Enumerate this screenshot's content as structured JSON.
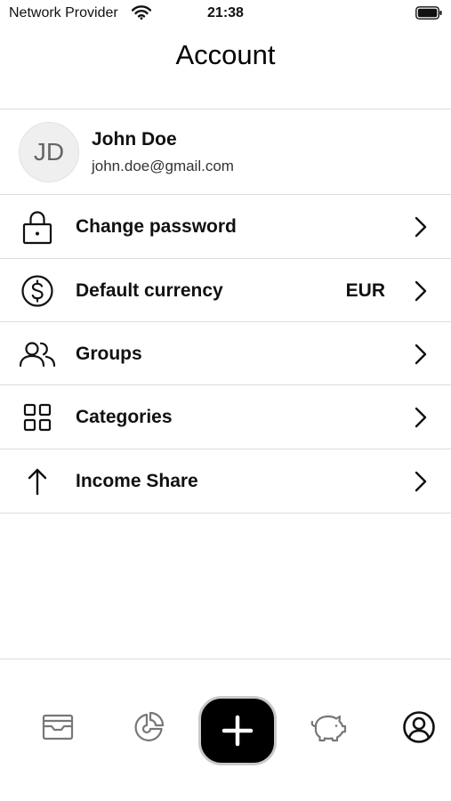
{
  "status_bar": {
    "carrier": "Network Provider",
    "time": "21:38",
    "wifi_icon": "wifi-icon",
    "battery_icon": "battery-icon"
  },
  "header": {
    "title": "Account"
  },
  "profile": {
    "initials": "JD",
    "name": "John Doe",
    "email": "john.doe@gmail.com"
  },
  "menu": {
    "items": [
      {
        "label": "Change password",
        "icon": "lock-icon"
      },
      {
        "label": "Default currency",
        "icon": "dollar-circle-icon",
        "value": "EUR"
      },
      {
        "label": "Groups",
        "icon": "users-icon"
      },
      {
        "label": "Categories",
        "icon": "grid-icon"
      },
      {
        "label": "Income Share",
        "icon": "arrow-up-icon"
      }
    ]
  },
  "tabbar": {
    "tabs": [
      {
        "icon": "wallet-icon"
      },
      {
        "icon": "pie-chart-icon"
      },
      {
        "icon": "add-icon"
      },
      {
        "icon": "piggy-bank-icon"
      },
      {
        "icon": "user-circle-icon"
      }
    ]
  }
}
